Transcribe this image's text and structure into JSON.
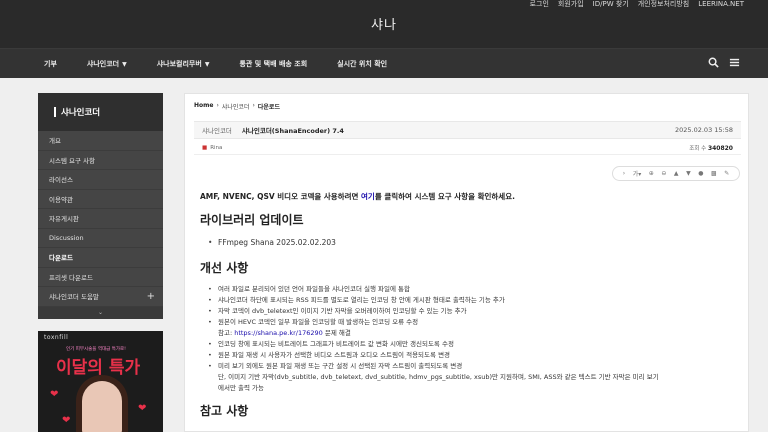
{
  "header": {
    "util_links": [
      "로그인",
      "회원가입",
      "ID/PW 찾기",
      "개인정보처리방침",
      "LEERINA.NET"
    ],
    "logo": "샤나"
  },
  "nav": {
    "items": [
      {
        "label": "기부",
        "has_dropdown": false
      },
      {
        "label": "샤나인코더",
        "has_dropdown": true
      },
      {
        "label": "샤나보컬리무버",
        "has_dropdown": true
      },
      {
        "label": "통관 및 택배 배송 조회",
        "has_dropdown": false
      },
      {
        "label": "실시간 위치 확인",
        "has_dropdown": false
      }
    ],
    "icons": [
      "search-icon",
      "menu-icon"
    ]
  },
  "sidebar": {
    "title": "샤나인코더",
    "items": [
      {
        "label": "개요",
        "active": false
      },
      {
        "label": "시스템 요구 사항",
        "active": false
      },
      {
        "label": "라이선스",
        "active": false
      },
      {
        "label": "이용약관",
        "active": false
      },
      {
        "label": "자유게시판",
        "active": false
      },
      {
        "label": "Discussion",
        "active": false
      },
      {
        "label": "다운로드",
        "active": true
      },
      {
        "label": "프리셋 다운로드",
        "active": false
      },
      {
        "label": "샤나인코더 도움말",
        "active": false,
        "expandable": true
      }
    ],
    "collapse_icon": "chevron-down-icon"
  },
  "ad": {
    "brand": "toxnfill",
    "subtitle": "인기 피부시술을 역대급 특가로!",
    "title": "이달의 특가"
  },
  "breadcrumb": [
    "Home",
    "샤나인코더",
    "다운로드"
  ],
  "post": {
    "category": "샤나인코더",
    "title": "샤나인코더(ShanaEncoder) 7.4",
    "date": "2025.02.03 15:58",
    "author": "Rina",
    "views_label": "조회 수",
    "views": "340820"
  },
  "toolbar": {
    "font_size_label": "가",
    "icons": [
      "chevron-right-icon",
      "font-size-icon",
      "zoom-in-icon",
      "zoom-out-icon",
      "arrow-up-icon",
      "arrow-down-icon",
      "comment-icon",
      "print-icon",
      "attachment-icon"
    ]
  },
  "article": {
    "lead_pre": "AMF, NVENC, QSV 비디오 코덱을 사용하려면 ",
    "lead_link": "여기",
    "lead_post": "를 클릭하여 시스템 요구 사항을 확인하세요.",
    "library_heading": "라이브러리 업데이트",
    "library_items": [
      "FFmpeg Shana 2025.02.02.203"
    ],
    "improve_heading": "개선 사항",
    "improve_items": [
      "여러 파일로 분리되어 있던 언어 파일들을 샤나인코더 실행 파일에 통합",
      "샤나인코더 하단에 표시되는 RSS 피드를 별도로 열리는 인코딩 창 안에 게시판 형태로 출력하는 기능 추가",
      "자막 코덱이 dvb_teletext인 이미지 기반 자막을 오버레이하여 인코딩할 수 있는 기능 추가",
      "원본이 HEVC 코덱인 일부 파일을 인코딩할 때 발생하는 인코딩 오류 수정"
    ],
    "ref_label": "참고: ",
    "ref_link": "https://shana.pe.kr/176290",
    "ref_suffix": " 문제 해결",
    "improve_items2": [
      "인코딩 창에 표시되는 비트레이트 그래프가 비트레이트 값 변화 시에만 갱신되도록 수정",
      "원본 파일 재생 시 사용자가 선택한 비디오 스트림과 오디오 스트림이 적용되도록 변경",
      "미리 보기 외에도 원본 파일 재생 또는 구간 설정 시 선택된 자막 스트림이 출력되도록 변경"
    ],
    "last_cont": "단, 이미지 기반 자막(dvb_subtitle, dvb_teletext, dvd_subtitle, hdmv_pgs_subtitle, xsub)만 지원하며, SMI, ASS와 같은 텍스트 기반 자막은 미리 보기",
    "last_cont2": "에서만 출력 가능",
    "notes_heading": "참고 사항"
  }
}
